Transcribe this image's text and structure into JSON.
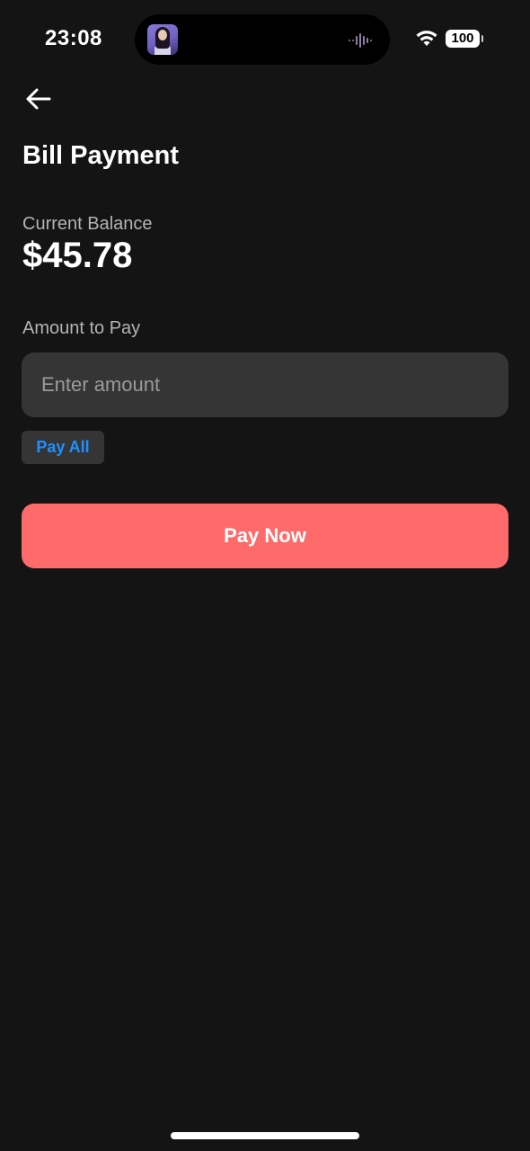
{
  "status_bar": {
    "time": "23:08",
    "battery": "100",
    "icons": [
      "wifi-icon",
      "battery-icon",
      "audio-wave-icon"
    ]
  },
  "header": {
    "back_icon": "arrow-left-icon",
    "title": "Bill Payment"
  },
  "balance": {
    "label": "Current Balance",
    "value": "$45.78"
  },
  "payment": {
    "amount_label": "Amount to Pay",
    "amount_value": "",
    "amount_placeholder": "Enter amount",
    "pay_all_label": "Pay All",
    "pay_now_label": "Pay Now"
  },
  "colors": {
    "background": "#141414",
    "input_background": "#353535",
    "accent_link": "#1e90ff",
    "primary_button": "#ff6b6b",
    "secondary_text": "#b4b4b4"
  }
}
